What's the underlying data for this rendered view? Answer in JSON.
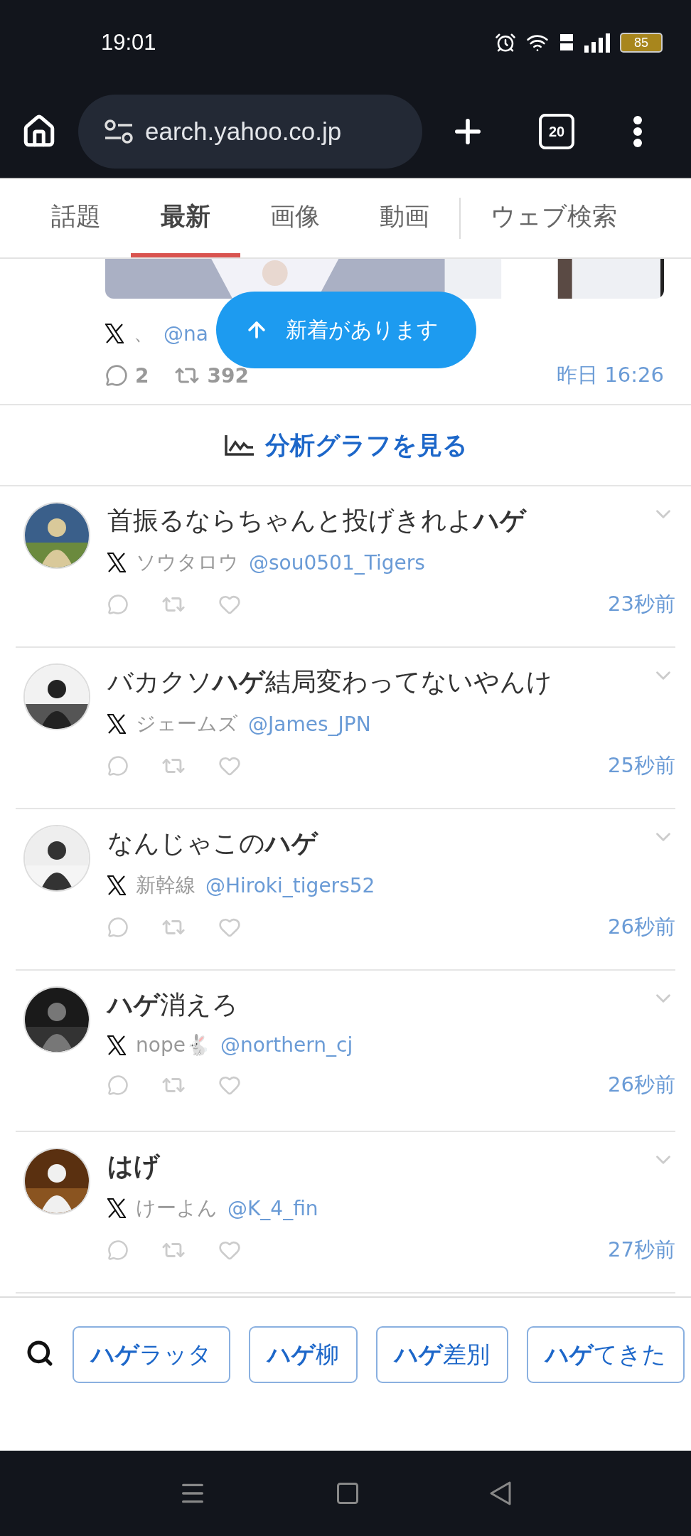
{
  "status_bar": {
    "time": "19:01",
    "battery": "85"
  },
  "browser": {
    "url": "earch.yahoo.co.jp",
    "tab_count": "20"
  },
  "tabs": [
    {
      "label": "話題",
      "selected": false
    },
    {
      "label": "最新",
      "selected": true
    },
    {
      "label": "画像",
      "selected": false
    },
    {
      "label": "動画",
      "selected": false
    },
    {
      "label": "ウェブ検索",
      "selected": false
    }
  ],
  "toast": {
    "label": "新着があります"
  },
  "top_post": {
    "name": "、",
    "handle": "@na",
    "replies": "2",
    "reposts": "392",
    "time": "昨日 16:26"
  },
  "analysis_link": {
    "label": "分析グラフを見る"
  },
  "posts": [
    {
      "text": "首振るならちゃんと投げきれよ**ハゲ**",
      "bold": false,
      "name": "ソウタロウ",
      "handle": "@sou0501_Tigers",
      "time": "23秒前"
    },
    {
      "text": "バカクソ**ハゲ**結局変わってないやんけ",
      "bold": false,
      "name": "ジェームズ",
      "handle": "@James_JPN",
      "time": "25秒前"
    },
    {
      "text": "なんじゃこの**ハゲ**",
      "bold": false,
      "name": "新幹線",
      "handle": "@Hiroki_tigers52",
      "time": "26秒前"
    },
    {
      "text": "**ハゲ**消えろ",
      "bold": false,
      "name": "nope🐇",
      "handle": "@northern_cj",
      "time": "26秒前"
    },
    {
      "text": "はげ",
      "bold": true,
      "name": "けーよん",
      "handle": "@K_4_fin",
      "time": "27秒前"
    }
  ],
  "related": [
    {
      "label": "**ハゲ**ラッタ"
    },
    {
      "label": "**ハゲ**柳"
    },
    {
      "label": "**ハゲ**差別"
    },
    {
      "label": "**ハゲ**てきた"
    }
  ]
}
